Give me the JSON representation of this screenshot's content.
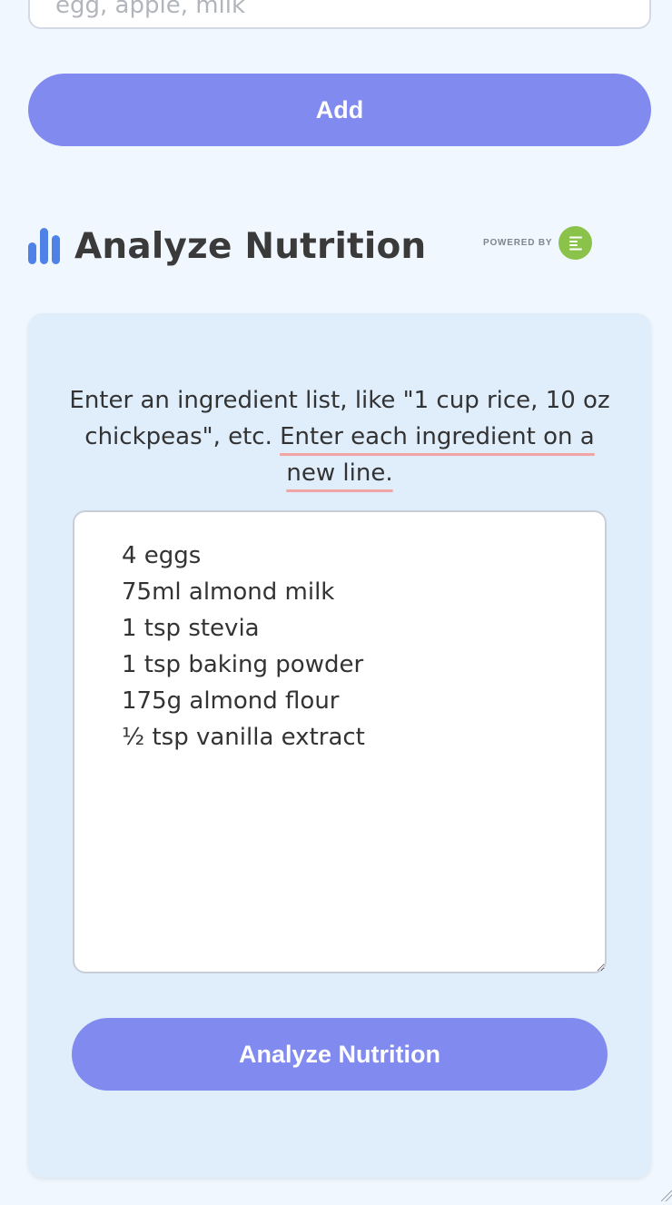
{
  "ingredient_input": {
    "placeholder": "egg, apple, milk",
    "value": ""
  },
  "add_button": {
    "label": "Add"
  },
  "analyze_section": {
    "icon": "bar-chart-icon",
    "title": "Analyze Nutrition",
    "powered_by": "POWERED BY",
    "logo_icon": "edamam-logo-icon",
    "instructions_plain": "Enter an ingredient list, like \"1 cup rice, 10 oz chickpeas\", etc.",
    "instructions_emphasis": "Enter each ingredient on a new line.",
    "ingredients_text": "4 eggs\n75ml almond milk\n1 tsp stevia\n1 tsp baking powder\n175g almond flour\n½ tsp vanilla extract",
    "analyze_button": "Analyze Nutrition"
  },
  "colors": {
    "page_background": "#f0f7fe",
    "card_background": "#e0edfb",
    "button": "#818aef",
    "icon_blue": "#4f82e6",
    "logo_green": "#8bc34a",
    "underline": "#f2a3a3"
  }
}
